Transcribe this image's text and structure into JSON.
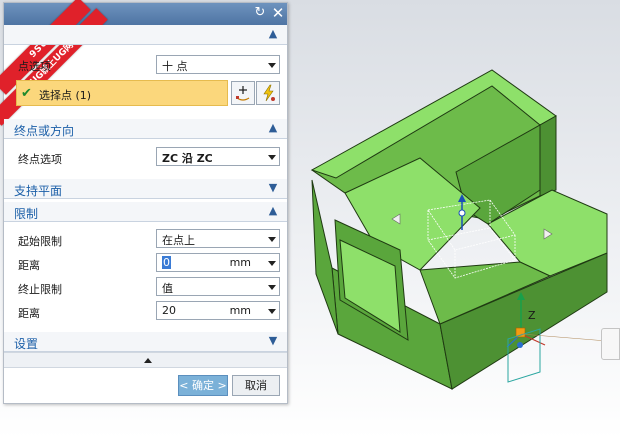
{
  "watermark": {
    "line1": "9SUG",
    "line2": "学UG就上UG网"
  },
  "title_buttons": {
    "reset_icon": "reset-icon",
    "close_icon": "close-icon"
  },
  "sections": {
    "start_point": {
      "option_label": "点选项",
      "option_value": "十 点",
      "select_point_label": "选择点 (1)"
    },
    "end_point": {
      "title": "终点或方向",
      "option_label": "终点选项",
      "option_value": "ZC 沿 ZC"
    },
    "support_plane": {
      "title": "支持平面"
    },
    "limits": {
      "title": "限制",
      "start_limit_label": "起始限制",
      "start_limit_value": "在点上",
      "distance_label_1": "距离",
      "distance_value_1": "0",
      "distance_unit_1": "mm",
      "end_limit_label": "终止限制",
      "end_limit_value": "值",
      "distance_label_2": "距离",
      "distance_value_2": "20",
      "distance_unit_2": "mm"
    },
    "settings": {
      "title": "设置"
    }
  },
  "footer": {
    "ok_label": "< 确定 >",
    "cancel_label": "取消"
  },
  "colors": {
    "model_face": "#6dbb4a",
    "model_top": "#8ee06a",
    "model_edge": "#1f3a12",
    "title_bar": "#5a7fad",
    "section_text": "#1b5fa8",
    "highlight_row": "#fbd77c"
  }
}
